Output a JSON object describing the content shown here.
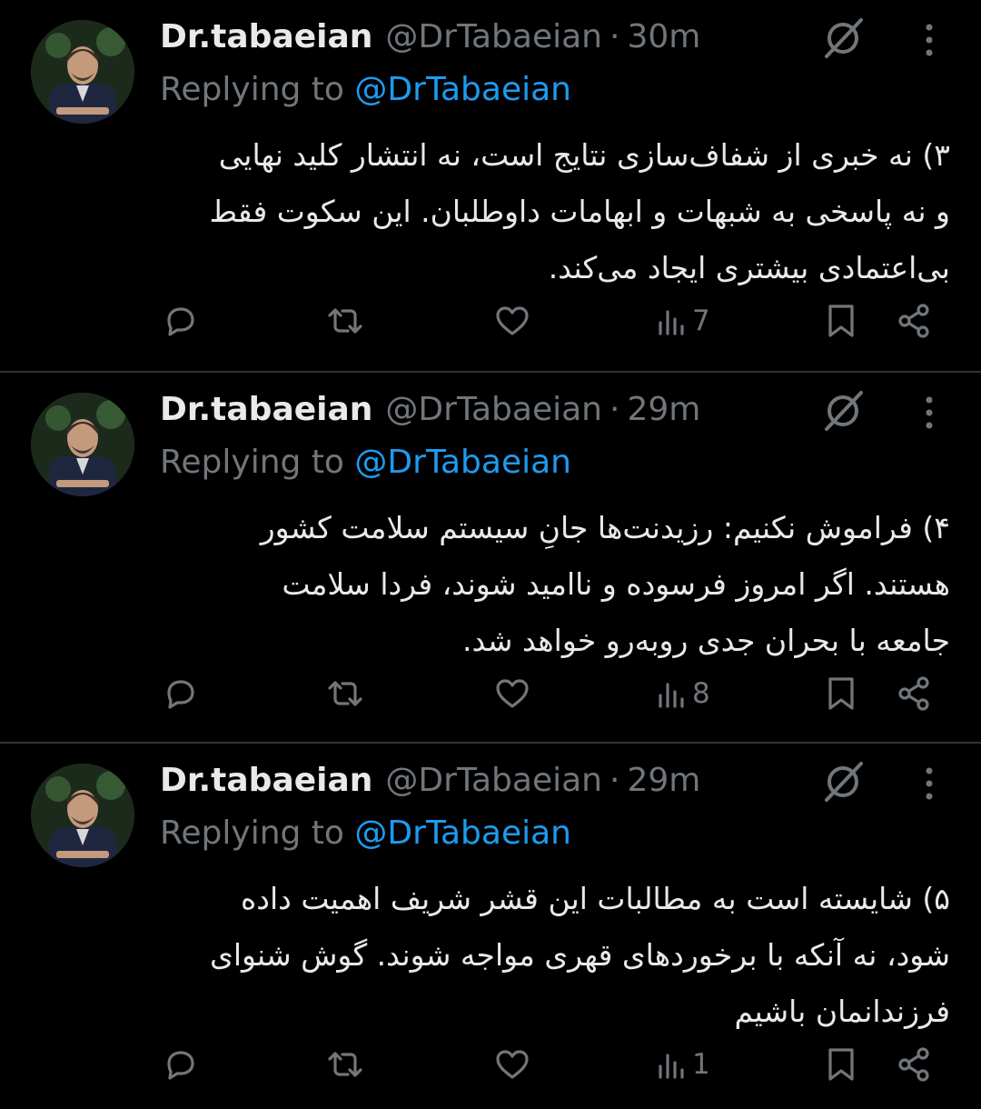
{
  "colors": {
    "background": "#000000",
    "primary_text": "#e7e9ea",
    "secondary_text": "#71767b",
    "link": "#1d9bf0",
    "divider": "#2f3336"
  },
  "icons": {
    "grok": "grok-icon",
    "more": "more-vertical-icon",
    "reply": "reply-icon",
    "retweet": "retweet-icon",
    "like": "heart-icon",
    "views": "views-icon",
    "bookmark": "bookmark-icon",
    "share": "share-icon"
  },
  "tweets": [
    {
      "display_name": "Dr.tabaeian",
      "handle": "@DrTabaeian",
      "separator": "·",
      "time": "30m",
      "replying_prefix": "Replying to",
      "replying_to": "@DrTabaeian",
      "lines": [
        "۳) نه خبری از شفاف‌سازی نتایج است، نه انتشار کلید نهایی",
        "و نه پاسخی به شبهات و ابهامات داوطلبان. این سکوت فقط",
        "بی‌اعتمادی بیشتری ایجاد می‌کند."
      ],
      "views": "7"
    },
    {
      "display_name": "Dr.tabaeian",
      "handle": "@DrTabaeian",
      "separator": "·",
      "time": "29m",
      "replying_prefix": "Replying to",
      "replying_to": "@DrTabaeian",
      "lines": [
        "۴) فراموش نکنیم: رزیدنت‌ها جانِ سیستم سلامت کشور",
        "هستند. اگر امروز فرسوده و ناامید شوند، فردا سلامت",
        "جامعه با بحران جدی روبه‌رو خواهد شد."
      ],
      "views": "8"
    },
    {
      "display_name": "Dr.tabaeian",
      "handle": "@DrTabaeian",
      "separator": "·",
      "time": "29m",
      "replying_prefix": "Replying to",
      "replying_to": "@DrTabaeian",
      "lines": [
        "۵) شایسته است به مطالبات این قشر شریف اهمیت داده",
        "شود، نه آنکه با برخوردهای قهری مواجه شوند. گوش شنوای",
        "فرزندانمان باشیم"
      ],
      "views": "1"
    }
  ]
}
